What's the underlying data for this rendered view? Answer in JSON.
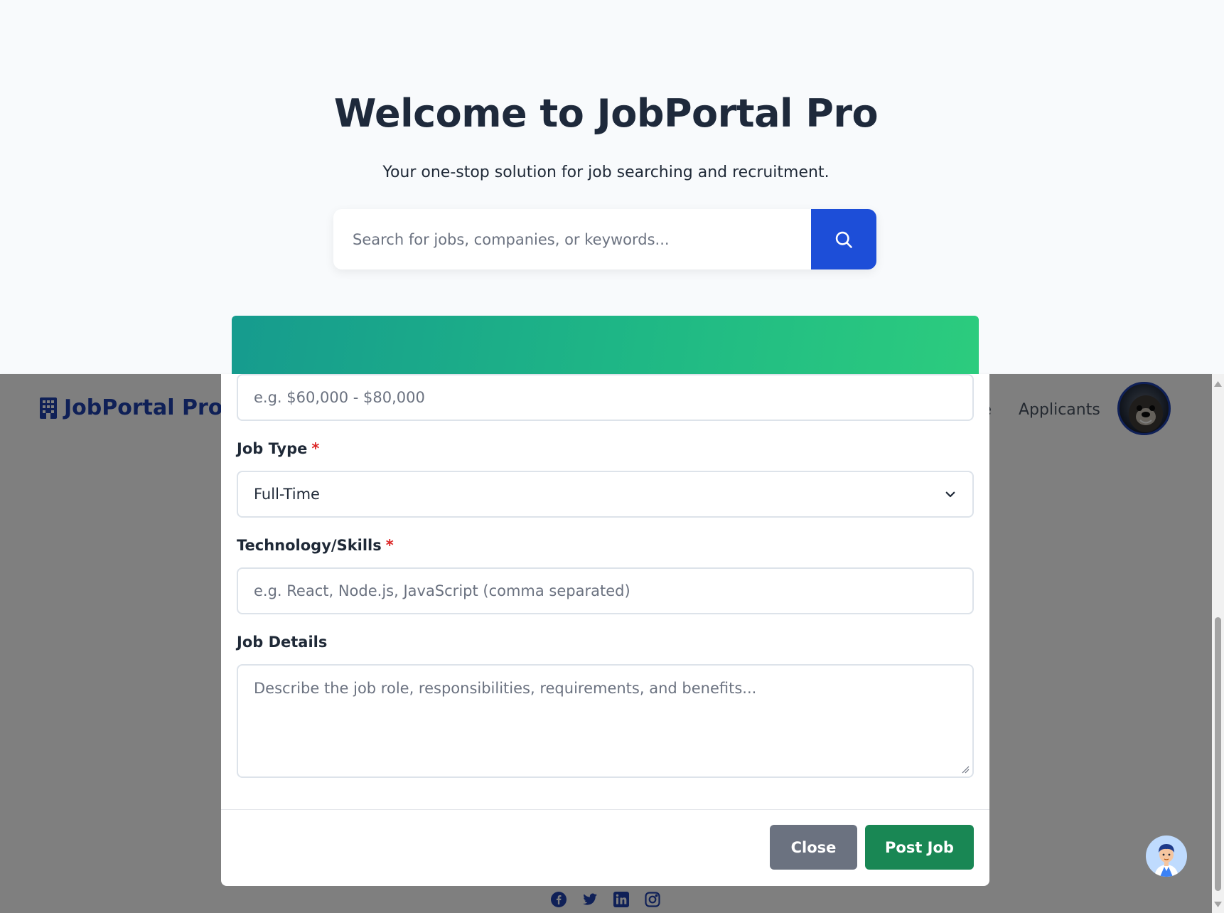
{
  "hero": {
    "title": "Welcome to JobPortal Pro",
    "subtitle": "Your one-stop solution for job searching and recruitment.",
    "search_placeholder": "Search for jobs, companies, or keywords..."
  },
  "navbar": {
    "brand": "JobPortal Pro",
    "partial_link": "se",
    "applicants": "Applicants"
  },
  "modal": {
    "salary_placeholder": "e.g. $60,000 - $80,000",
    "job_type_label": "Job Type",
    "job_type_value": "Full-Time",
    "skills_label": "Technology/Skills",
    "skills_placeholder": "e.g. React, Node.js, JavaScript (comma separated)",
    "details_label": "Job Details",
    "details_placeholder": "Describe the job role, responsibilities, requirements, and benefits...",
    "required_mark": "*",
    "close_label": "Close",
    "post_label": "Post Job"
  },
  "icons": {
    "brand": "building-icon",
    "search": "search-icon",
    "chevron": "chevron-down-icon",
    "socials": [
      "facebook-icon",
      "twitter-icon",
      "linkedin-icon",
      "instagram-icon"
    ]
  },
  "colors": {
    "primary": "#1d4ed8",
    "brand": "#1e40af",
    "header_gradient_start": "#169b8e",
    "header_gradient_end": "#2ccc7e",
    "post_button": "#198754",
    "close_button": "#6b7280"
  }
}
